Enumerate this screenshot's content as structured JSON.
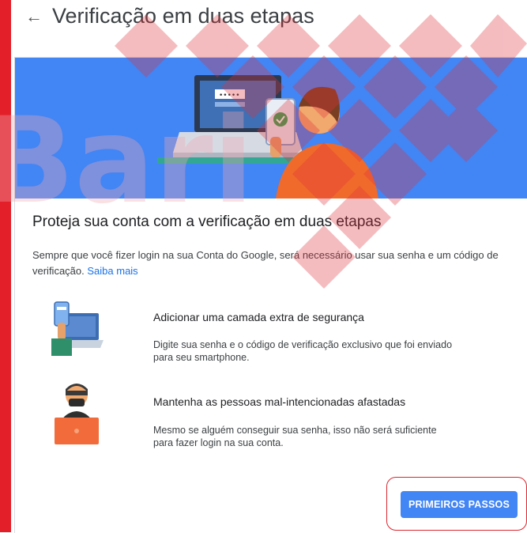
{
  "header": {
    "back_icon": "arrow-back-icon",
    "title": "Verificação em duas etapas"
  },
  "card": {
    "headline": "Proteja sua conta com a verificação em duas etapas",
    "intro_text": "Sempre que você fizer login na sua Conta do Google, será necessário usar sua senha e um código de verificação.",
    "learn_more_link": "Saiba mais"
  },
  "features": [
    {
      "icon": "phone-laptop-icon",
      "title": "Adicionar uma camada extra de segurança",
      "description": "Digite sua senha e o código de verificação exclusivo que foi enviado para seu smartphone."
    },
    {
      "icon": "hacker-icon",
      "title": "Mantenha as pessoas mal-intencionadas afastadas",
      "description": "Mesmo se alguém conseguir sua senha, isso não será suficiente para fazer login na sua conta."
    }
  ],
  "action": {
    "get_started_label": "PRIMEIROS PASSOS"
  },
  "colors": {
    "accent": "#4285f4",
    "link": "#1a73e8",
    "frame": "#e3202a",
    "watermark": "#e0323c"
  }
}
